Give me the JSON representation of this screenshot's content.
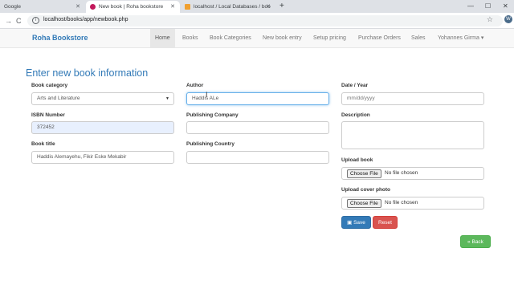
{
  "browser": {
    "tabs": [
      {
        "title": "Google"
      },
      {
        "title": "New book | Roha bookstore"
      },
      {
        "title": "localhost / Local Databases / boo"
      }
    ],
    "url": "localhost/books/app/newbook.php",
    "profile_initial": "W"
  },
  "navbar": {
    "brand": "Roha Bookstore",
    "items": [
      "Home",
      "Books",
      "Book Categories",
      "New book entry",
      "Setup pricing",
      "Purchase Orders",
      "Sales",
      "Yohannes Girma ▾"
    ]
  },
  "form": {
    "heading": "Enter new book information",
    "book_category": {
      "label": "Book category",
      "value": "Arts and Literature"
    },
    "isbn": {
      "label": "ISBN Number",
      "value": "372452"
    },
    "book_title": {
      "label": "Book title",
      "value": "Haddis Alemayehu, Fikir Eske Mekabir"
    },
    "author": {
      "label": "Author",
      "value": "Haddis ALe"
    },
    "publishing_company": {
      "label": "Publishing Company",
      "value": ""
    },
    "publishing_country": {
      "label": "Publishing Country",
      "value": ""
    },
    "date_year": {
      "label": "Date / Year",
      "placeholder": "mm/dd/yyyy"
    },
    "description": {
      "label": "Description",
      "value": ""
    },
    "upload_book": {
      "label": "Upload book",
      "button": "Choose File",
      "status": "No file chosen"
    },
    "upload_cover": {
      "label": "Upload cover photo",
      "button": "Choose File",
      "status": "No file chosen"
    },
    "save_label": "Save",
    "reset_label": "Reset",
    "back_label": "Back"
  },
  "colors": {
    "accent": "#337ab7",
    "danger": "#d9534f",
    "success": "#5cb85c"
  }
}
